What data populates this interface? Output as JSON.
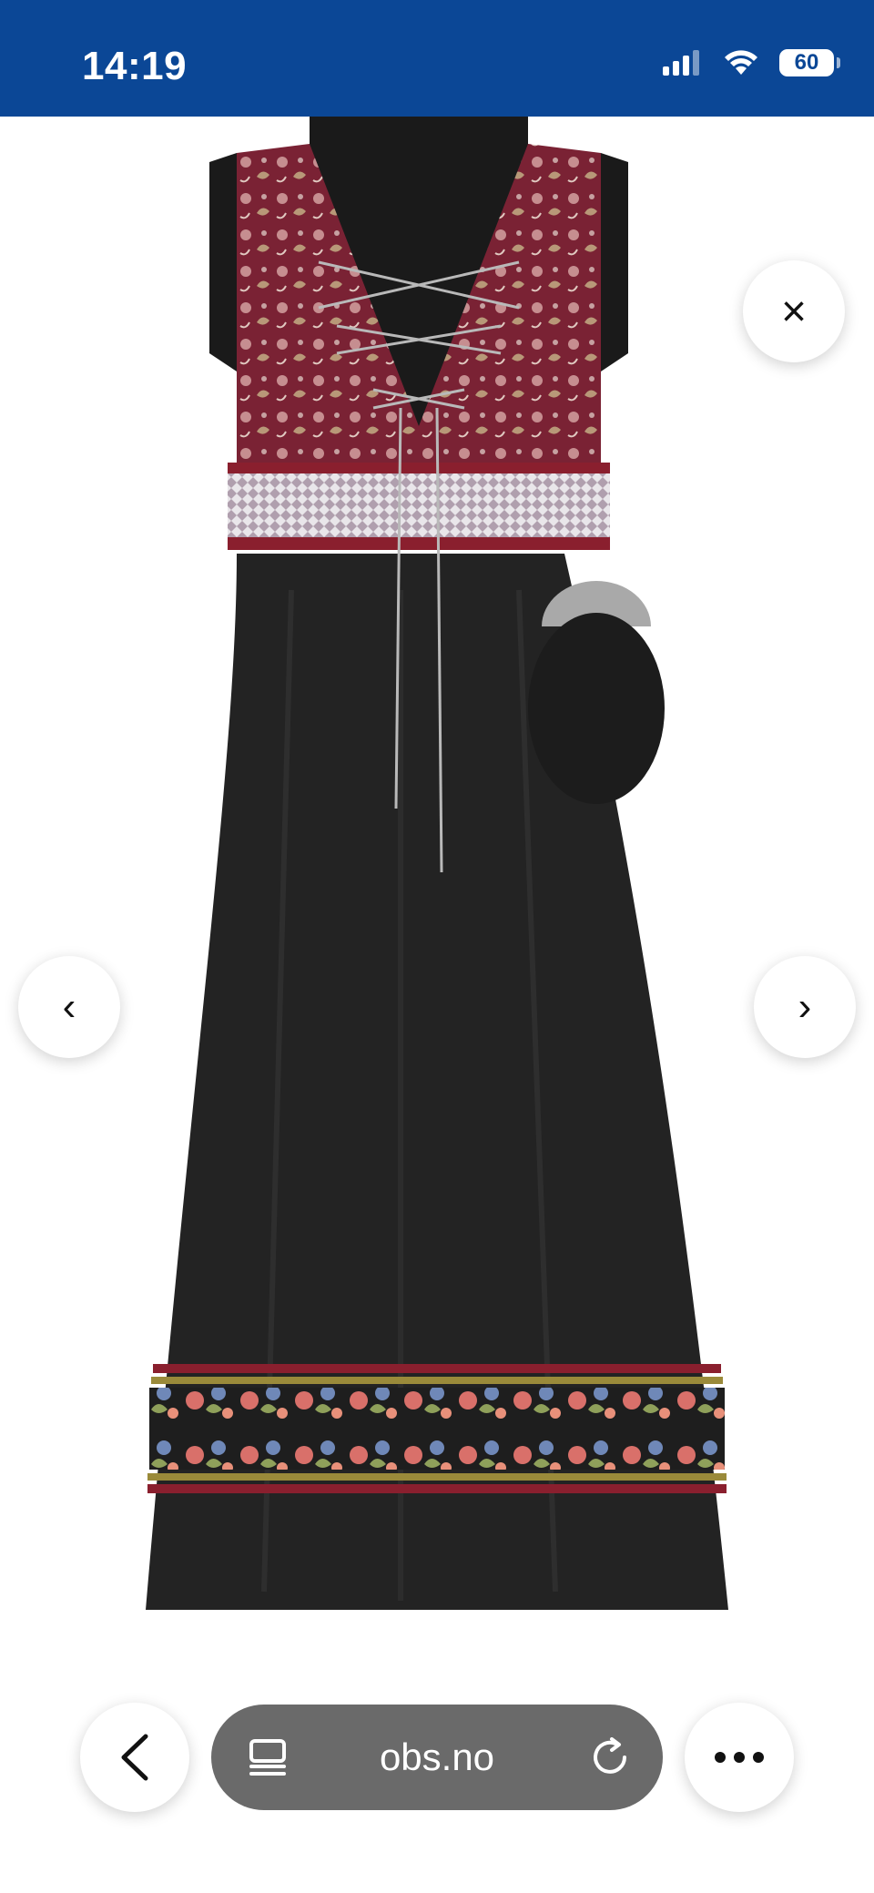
{
  "status_bar": {
    "time": "14:19",
    "battery": "60",
    "icons": [
      "cellular-signal-icon",
      "wifi-icon",
      "battery-icon"
    ],
    "background": "#0b4796"
  },
  "viewer": {
    "image_alt": "Black bunad dress with burgundy brocade bodice, woven belt, silver chains and pouch",
    "close_symbol": "×",
    "prev_symbol": "‹",
    "next_symbol": "›"
  },
  "toolbar": {
    "url": "obs.no",
    "back_icon": "chevron-left-icon",
    "reader_icon": "reader-mode-icon",
    "reload_icon": "reload-icon",
    "more_icon": "more-dots-icon"
  }
}
